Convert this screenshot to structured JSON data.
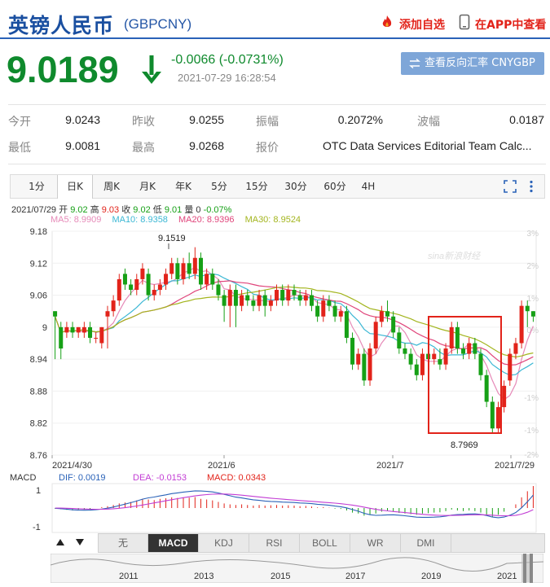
{
  "header": {
    "title": "英镑人民币",
    "code": "(GBPCNY)",
    "add_watch": "添加自选",
    "view_app": "在APP中查看"
  },
  "quote": {
    "price": "9.0189",
    "change": "-0.0066 (-0.0731%)",
    "timestamp": "2021-07-29 16:28:54",
    "reverse_button": "查看反向汇率 CNYGBP"
  },
  "stats": [
    {
      "label": "今开",
      "value": "9.0243"
    },
    {
      "label": "昨收",
      "value": "9.0255"
    },
    {
      "label": "振幅",
      "value": "0.2072%"
    },
    {
      "label": "波幅",
      "value": "0.0187"
    },
    {
      "label": "最低",
      "value": "9.0081"
    },
    {
      "label": "最高",
      "value": "9.0268"
    },
    {
      "label": "报价",
      "value": "OTC Data Services Editorial Team Calc..."
    }
  ],
  "tabs": [
    "1分",
    "日K",
    "周K",
    "月K",
    "年K",
    "5分",
    "15分",
    "30分",
    "60分",
    "4H"
  ],
  "active_tab": "日K",
  "info_line": {
    "date": "2021/07/29",
    "open_lbl": "开",
    "open": "9.02",
    "high_lbl": "高",
    "high": "9.03",
    "close_lbl": "收",
    "close": "9.02",
    "low_lbl": "低",
    "low": "9.01",
    "vol_lbl": "量",
    "vol": "0",
    "pct": "-0.07%"
  },
  "ma_legend": [
    {
      "label": "MA5: 8.9909",
      "color": "#e68ab8"
    },
    {
      "label": "MA10: 8.9358",
      "color": "#3bb7d4"
    },
    {
      "label": "MA20: 8.9396",
      "color": "#e0457b"
    },
    {
      "label": "MA30: 8.9524",
      "color": "#a3b51e"
    }
  ],
  "watermark": "sina新浪财经",
  "macd_legend": {
    "title": "MACD",
    "dif": "DIF: 0.0019",
    "dea": "DEA: -0.0153",
    "macd": "MACD: 0.0343"
  },
  "indicators": [
    "无",
    "MACD",
    "KDJ",
    "RSI",
    "BOLL",
    "WR",
    "DMI"
  ],
  "active_indicator": "MACD",
  "nav_years": [
    "2011",
    "2013",
    "2015",
    "2017",
    "2019",
    "2021"
  ],
  "colors": {
    "up": "#e2231a",
    "down": "#16a016",
    "accent": "#2a62b8"
  },
  "chart_data": {
    "type": "candlestick",
    "y_ticks": [
      "9.18",
      "9.12",
      "9.06",
      "9",
      "8.94",
      "8.88",
      "8.82",
      "8.76"
    ],
    "pct_ticks": [
      "3%",
      "2%",
      "1%",
      "0%",
      "-1%",
      "-1%",
      "-2%"
    ],
    "x_ticks": [
      "2021/4/30",
      "2021/6",
      "2021/7",
      "2021/7/29"
    ],
    "ylim": [
      8.76,
      9.18
    ],
    "annotations": {
      "high": "9.1519",
      "low": "8.7969"
    },
    "macd_ticks": [
      "1",
      "-1"
    ],
    "candles": [
      [
        9.03,
        9.02,
        9.03,
        8.94
      ],
      [
        9.0,
        8.96,
        9.01,
        8.94
      ],
      [
        8.99,
        9.0,
        9.01,
        8.98
      ],
      [
        9.0,
        8.99,
        9.01,
        8.98
      ],
      [
        8.99,
        9.0,
        9.0,
        8.98
      ],
      [
        8.99,
        9.0,
        9.01,
        8.98
      ],
      [
        9.0,
        8.98,
        9.01,
        8.97
      ],
      [
        8.98,
        8.98,
        8.99,
        8.97
      ],
      [
        8.97,
        9.0,
        9.0,
        8.96
      ],
      [
        9.02,
        9.03,
        9.04,
        8.96
      ],
      [
        9.03,
        9.05,
        9.06,
        9.02
      ],
      [
        9.05,
        9.09,
        9.1,
        9.04
      ],
      [
        9.1,
        9.08,
        9.11,
        9.07
      ],
      [
        9.08,
        9.07,
        9.09,
        9.06
      ],
      [
        9.07,
        9.09,
        9.1,
        9.06
      ],
      [
        9.09,
        9.11,
        9.12,
        9.08
      ],
      [
        9.1,
        9.06,
        9.11,
        9.05
      ],
      [
        9.06,
        9.07,
        9.08,
        9.05
      ],
      [
        9.07,
        9.08,
        9.09,
        9.06
      ],
      [
        9.08,
        9.1,
        9.11,
        9.07
      ],
      [
        9.1,
        9.12,
        9.13,
        9.09
      ],
      [
        9.12,
        9.09,
        9.13,
        9.08
      ],
      [
        9.09,
        9.12,
        9.13,
        9.08
      ],
      [
        9.12,
        9.1,
        9.14,
        9.09
      ],
      [
        9.1,
        9.13,
        9.15,
        9.09
      ],
      [
        9.13,
        9.08,
        9.14,
        9.07
      ],
      [
        9.08,
        9.1,
        9.11,
        9.07
      ],
      [
        9.1,
        9.08,
        9.11,
        9.07
      ],
      [
        9.08,
        9.06,
        9.09,
        9.05
      ],
      [
        9.06,
        9.04,
        9.07,
        9.01
      ],
      [
        9.04,
        9.07,
        9.08,
        9.0
      ],
      [
        9.07,
        9.04,
        9.08,
        9.0
      ],
      [
        9.04,
        9.06,
        9.07,
        9.03
      ],
      [
        9.06,
        9.05,
        9.07,
        9.04
      ],
      [
        9.05,
        9.04,
        9.06,
        9.03
      ],
      [
        9.04,
        9.06,
        9.07,
        9.03
      ],
      [
        9.06,
        9.04,
        9.07,
        9.02
      ],
      [
        9.04,
        9.05,
        9.06,
        9.03
      ],
      [
        9.05,
        9.07,
        9.08,
        9.04
      ],
      [
        9.07,
        9.05,
        9.08,
        9.04
      ],
      [
        9.05,
        9.07,
        9.08,
        9.04
      ],
      [
        9.07,
        9.06,
        9.08,
        9.05
      ],
      [
        9.06,
        9.05,
        9.07,
        9.04
      ],
      [
        9.05,
        9.06,
        9.07,
        9.04
      ],
      [
        9.06,
        9.04,
        9.07,
        9.03
      ],
      [
        9.04,
        9.02,
        9.05,
        9.01
      ],
      [
        9.02,
        9.05,
        9.06,
        9.01
      ],
      [
        9.05,
        9.04,
        9.06,
        9.03
      ],
      [
        9.04,
        9.02,
        9.05,
        9.01
      ],
      [
        9.02,
        9.03,
        9.04,
        9.01
      ],
      [
        9.03,
        8.98,
        9.04,
        8.97
      ],
      [
        8.98,
        8.93,
        8.99,
        8.92
      ],
      [
        8.93,
        8.95,
        8.96,
        8.92
      ],
      [
        8.95,
        8.9,
        8.96,
        8.89
      ],
      [
        8.9,
        8.96,
        8.97,
        8.89
      ],
      [
        8.96,
        9.01,
        9.02,
        8.95
      ],
      [
        9.01,
        9.03,
        9.04,
        9.0
      ],
      [
        9.03,
        9.02,
        9.05,
        9.01
      ],
      [
        9.02,
        8.99,
        9.03,
        8.98
      ],
      [
        8.99,
        8.96,
        9.0,
        8.95
      ],
      [
        8.96,
        8.95,
        8.97,
        8.94
      ],
      [
        8.95,
        8.93,
        8.96,
        8.92
      ],
      [
        8.93,
        8.91,
        8.94,
        8.9
      ],
      [
        8.91,
        8.95,
        8.96,
        8.9
      ],
      [
        8.95,
        8.94,
        8.96,
        8.93
      ],
      [
        8.94,
        8.95,
        8.96,
        8.93
      ],
      [
        8.94,
        8.93,
        8.96,
        8.92
      ],
      [
        8.93,
        8.96,
        8.97,
        8.92
      ],
      [
        8.96,
        9.0,
        9.01,
        8.95
      ],
      [
        9.0,
        8.96,
        9.01,
        8.95
      ],
      [
        8.96,
        8.95,
        8.97,
        8.94
      ],
      [
        8.95,
        8.97,
        8.98,
        8.94
      ],
      [
        8.97,
        8.95,
        8.98,
        8.94
      ],
      [
        8.95,
        8.91,
        8.96,
        8.9
      ],
      [
        8.91,
        8.86,
        8.92,
        8.85
      ],
      [
        8.86,
        8.81,
        8.87,
        8.8
      ],
      [
        8.81,
        8.85,
        8.86,
        8.8
      ],
      [
        8.85,
        8.89,
        8.9,
        8.84
      ],
      [
        8.9,
        8.95,
        8.96,
        8.89
      ],
      [
        8.95,
        8.97,
        8.98,
        8.94
      ],
      [
        8.97,
        9.04,
        9.05,
        8.96
      ],
      [
        9.04,
        9.03,
        9.05,
        9.0
      ],
      [
        9.03,
        9.02,
        9.03,
        9.01
      ]
    ],
    "macd_hist": [
      -0.02,
      -0.04,
      -0.06,
      -0.08,
      -0.06,
      -0.05,
      -0.03,
      0.0,
      0.03,
      0.06,
      0.1,
      0.15,
      0.18,
      0.2,
      0.25,
      0.3,
      0.28,
      0.26,
      0.3,
      0.32,
      0.35,
      0.33,
      0.35,
      0.34,
      0.36,
      0.3,
      0.28,
      0.25,
      0.2,
      0.15,
      0.12,
      0.1,
      0.12,
      0.1,
      0.08,
      0.1,
      0.08,
      0.09,
      0.1,
      0.08,
      0.09,
      0.08,
      0.06,
      0.07,
      0.05,
      0.02,
      0.03,
      0.01,
      -0.02,
      -0.03,
      -0.08,
      -0.15,
      -0.18,
      -0.25,
      -0.22,
      -0.18,
      -0.12,
      -0.1,
      -0.12,
      -0.16,
      -0.18,
      -0.2,
      -0.22,
      -0.18,
      -0.17,
      -0.15,
      -0.14,
      -0.1,
      -0.05,
      -0.08,
      -0.1,
      -0.08,
      -0.1,
      -0.15,
      -0.22,
      -0.28,
      -0.22,
      -0.12,
      0.0,
      0.12,
      0.35,
      0.55,
      0.72
    ]
  }
}
